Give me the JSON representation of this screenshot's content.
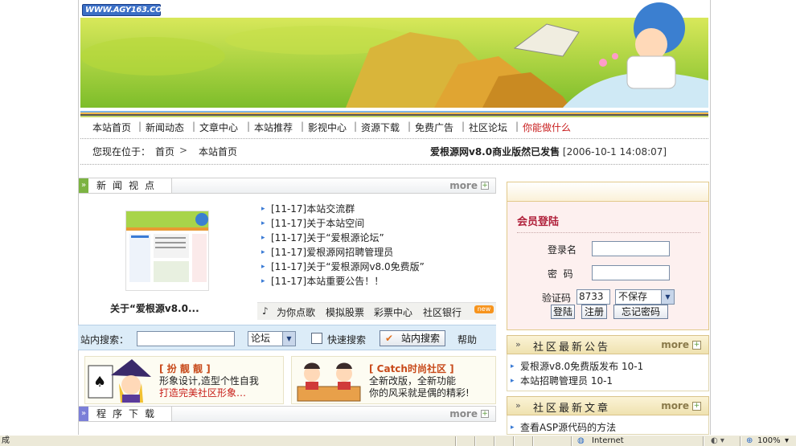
{
  "logo": {
    "text": "WWW.AGY163.COM"
  },
  "nav": {
    "items": [
      {
        "label": "本站首页",
        "color": "normal"
      },
      {
        "label": "新闻动态",
        "color": "normal"
      },
      {
        "label": "文章中心",
        "color": "normal"
      },
      {
        "label": "本站推荐",
        "color": "normal"
      },
      {
        "label": "影视中心",
        "color": "normal"
      },
      {
        "label": "资源下载",
        "color": "normal"
      },
      {
        "label": "免费广告",
        "color": "normal"
      },
      {
        "label": "社区论坛",
        "color": "normal"
      },
      {
        "label": "你能做什么",
        "color": "red"
      }
    ],
    "separator": "|"
  },
  "breadcrumb": {
    "prefix": "您现在位于：",
    "home": "首页",
    "arrow": ">",
    "current": "本站首页"
  },
  "headline": {
    "title": "爱根源网v8.0商业版然已发售",
    "date": "[2006-10-1 14:08:07]"
  },
  "news_section": {
    "title": "新闻视点",
    "more": "more",
    "thumb_caption": "关于“爱根源v8.0...",
    "items": [
      "[11-17]本站交流群",
      "[11-17]关于本站空间",
      "[11-17]关于“爱根源论坛”",
      "[11-17]爱根源网招聘管理员",
      "[11-17]关于“爱根源网v8.0免费版”",
      "[11-17]本站重要公告！！"
    ],
    "quick_links": [
      "为你点歌",
      "模拟股票",
      "彩票中心",
      "社区银行"
    ],
    "new_badge": "new"
  },
  "search": {
    "label": "站内搜索：",
    "value": "",
    "scope": "论坛",
    "quick_label": "快速搜索",
    "button": "站内搜索",
    "help": "帮助"
  },
  "promos": [
    {
      "title": "[ 扮 靓 靓 ]",
      "line1": "形象设计,造型个性自我",
      "line2": "打造完美社区形象…"
    },
    {
      "title": "[ Catch时尚社区 ]",
      "line1": "全新改版，全新功能",
      "line2": "你的风采就是偶的精彩!"
    }
  ],
  "download_section": {
    "title": "程序下载",
    "more": "more"
  },
  "login": {
    "title": "会员登陆",
    "username_label": "登录名",
    "password_label": "密  码",
    "captcha_label": "验证码",
    "captcha_value": "8733",
    "remember": "不保存",
    "login_button": "登陆",
    "register_button": "注册",
    "forgot_button": "忘记密码"
  },
  "notices": {
    "title": "社区最新公告",
    "more": "more",
    "items": [
      "爱根源v8.0免费版发布 10-1",
      "本站招聘管理员 10-1"
    ]
  },
  "articles": {
    "title": "社区最新文章",
    "more": "more",
    "items": [
      "查看ASP源代码的方法"
    ]
  },
  "statusbar": {
    "left": "成",
    "zone": "Internet",
    "zoom": "100%"
  },
  "colors": {
    "accent_red": "#c81e1e",
    "link_blue": "#3a7bd5",
    "search_bg": "#dcecf8",
    "login_bg": "#fdf0ef"
  }
}
